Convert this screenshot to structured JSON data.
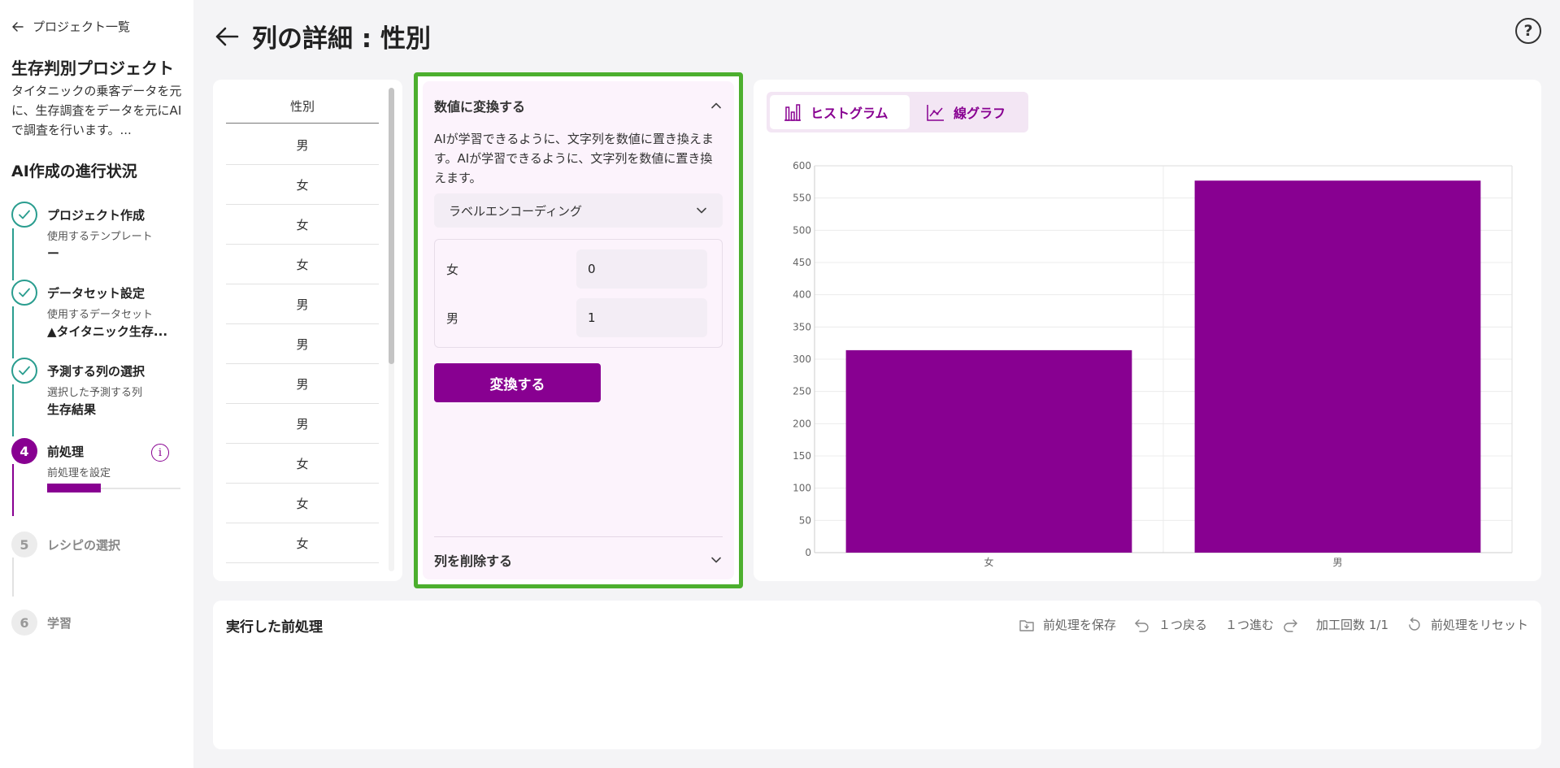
{
  "sidebar": {
    "back_label": "プロジェクト一覧",
    "project_title": "生存判別プロジェクト",
    "project_desc": "タイタニックの乗客データを元に、生存調査をデータを元にAIで調査を行います。...",
    "progress_title": "AI作成の進行状況",
    "steps": [
      {
        "label": "プロジェクト作成",
        "sub": "使用するテンプレート",
        "value": "ー"
      },
      {
        "label": "データセット設定",
        "sub": "使用するデータセット",
        "value": "▲タイタニック生存..."
      },
      {
        "label": "予測する列の選択",
        "sub": "選択した予測する列",
        "value": "生存結果"
      },
      {
        "number": "4",
        "label": "前処理",
        "sub": "前処理を設定",
        "progress": 0.4
      },
      {
        "number": "5",
        "label": "レシピの選択"
      },
      {
        "number": "6",
        "label": "学習"
      }
    ]
  },
  "header": {
    "title": "列の詳細 : 性別",
    "help": "?"
  },
  "column": {
    "header": "性別",
    "rows": [
      "男",
      "女",
      "女",
      "女",
      "男",
      "男",
      "男",
      "男",
      "女",
      "女",
      "女"
    ]
  },
  "transform": {
    "title": "数値に変換する",
    "description": "AIが学習できるように、文字列を数値に置き換えます。AIが学習できるように、文字列を数値に置き換えます。",
    "method": "ラベルエンコーディング",
    "mapping": [
      {
        "label": "女",
        "value": "0"
      },
      {
        "label": "男",
        "value": "1"
      }
    ],
    "convert_button": "変換する",
    "delete_section": "列を削除する"
  },
  "chart_tabs": {
    "histogram": "ヒストグラム",
    "line": "線グラフ"
  },
  "chart_data": {
    "type": "bar",
    "categories": [
      "女",
      "男"
    ],
    "values": [
      314,
      577
    ],
    "ylim": [
      0,
      600
    ],
    "yticks": [
      0,
      50,
      100,
      150,
      200,
      250,
      300,
      350,
      400,
      450,
      500,
      550,
      600
    ],
    "grid": true,
    "bar_color": "#880091"
  },
  "history": {
    "title": "実行した前処理",
    "save": "前処理を保存",
    "undo": "１つ戻る",
    "redo": "１つ進む",
    "count_label": "加工回数",
    "count_value": "1/1",
    "reset": "前処理をリセット"
  }
}
